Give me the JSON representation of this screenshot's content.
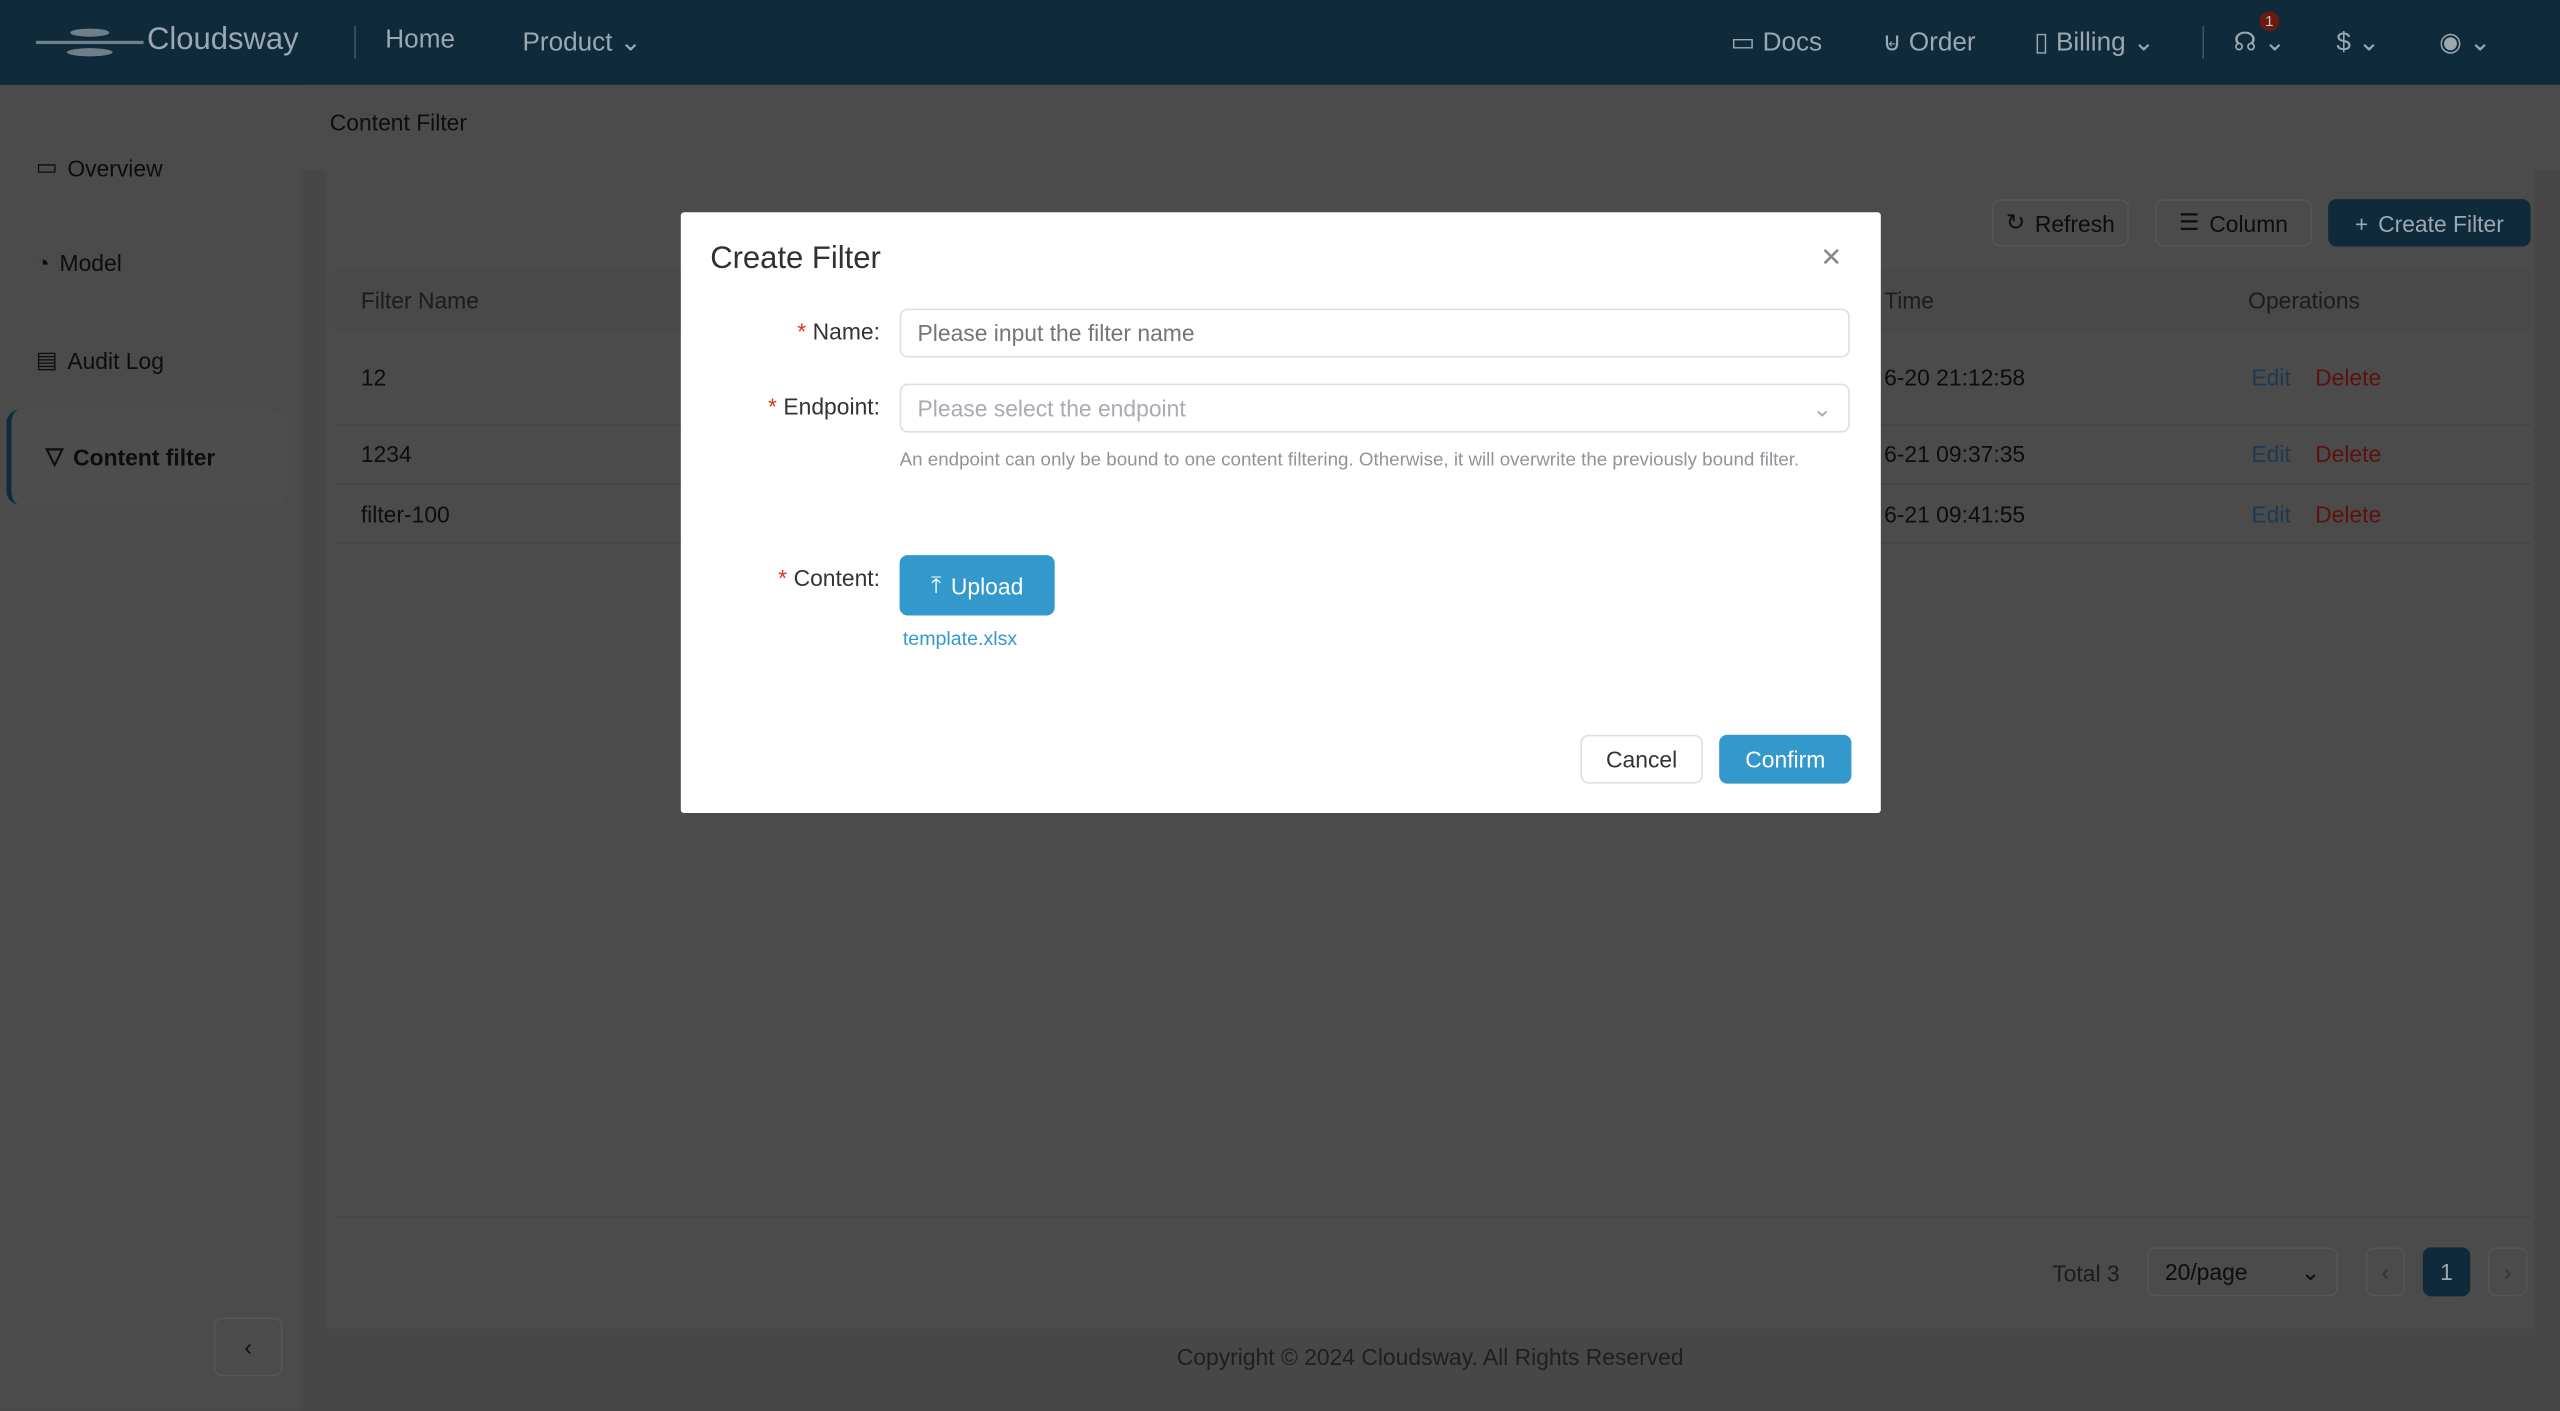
{
  "header": {
    "brand": "Cloudsway",
    "nav": [
      {
        "label": "Home"
      },
      {
        "label": "Product"
      }
    ],
    "right": [
      {
        "label": "Docs",
        "icon": "folder-icon"
      },
      {
        "label": "Order",
        "icon": "cart-icon"
      },
      {
        "label": "Billing",
        "icon": "bill-icon"
      }
    ],
    "notification_badge": "1",
    "colors": {
      "header_bg": "#33546a",
      "accent": "#3399cc"
    }
  },
  "sidebar": {
    "items": [
      {
        "label": "Overview",
        "icon": "monitor-icon"
      },
      {
        "label": "Model",
        "icon": "model-icon"
      },
      {
        "label": "Audit Log",
        "icon": "log-icon"
      },
      {
        "label": "Content filter",
        "icon": "filter-icon",
        "active": true
      }
    ],
    "collapse_icon": "chevron-left-icon"
  },
  "breadcrumb": "Content Filter",
  "toolbar": {
    "refresh": "Refresh",
    "column": "Column",
    "create": "Create Filter"
  },
  "table": {
    "columns": [
      "Filter Name",
      "Time",
      "Operations"
    ],
    "rows": [
      {
        "name": "12",
        "time": "6-20 21:12:58"
      },
      {
        "name": "1234",
        "time": "6-21 09:37:35"
      },
      {
        "name": "filter-100",
        "time": "6-21 09:41:55"
      }
    ],
    "edit": "Edit",
    "delete": "Delete"
  },
  "pagination": {
    "total": "Total 3",
    "page_size": "20/page",
    "current": "1"
  },
  "footer": "Copyright © 2024 Cloudsway. All Rights Reserved",
  "modal": {
    "title": "Create Filter",
    "name_label": "Name:",
    "name_placeholder": "Please input the filter name",
    "endpoint_label": "Endpoint:",
    "endpoint_placeholder": "Please select the endpoint",
    "endpoint_hint": "An endpoint can only be bound to one content filtering. Otherwise, it will overwrite the previously bound filter.",
    "content_label": "Content:",
    "upload": "Upload",
    "template": "template.xlsx",
    "cancel": "Cancel",
    "confirm": "Confirm"
  }
}
